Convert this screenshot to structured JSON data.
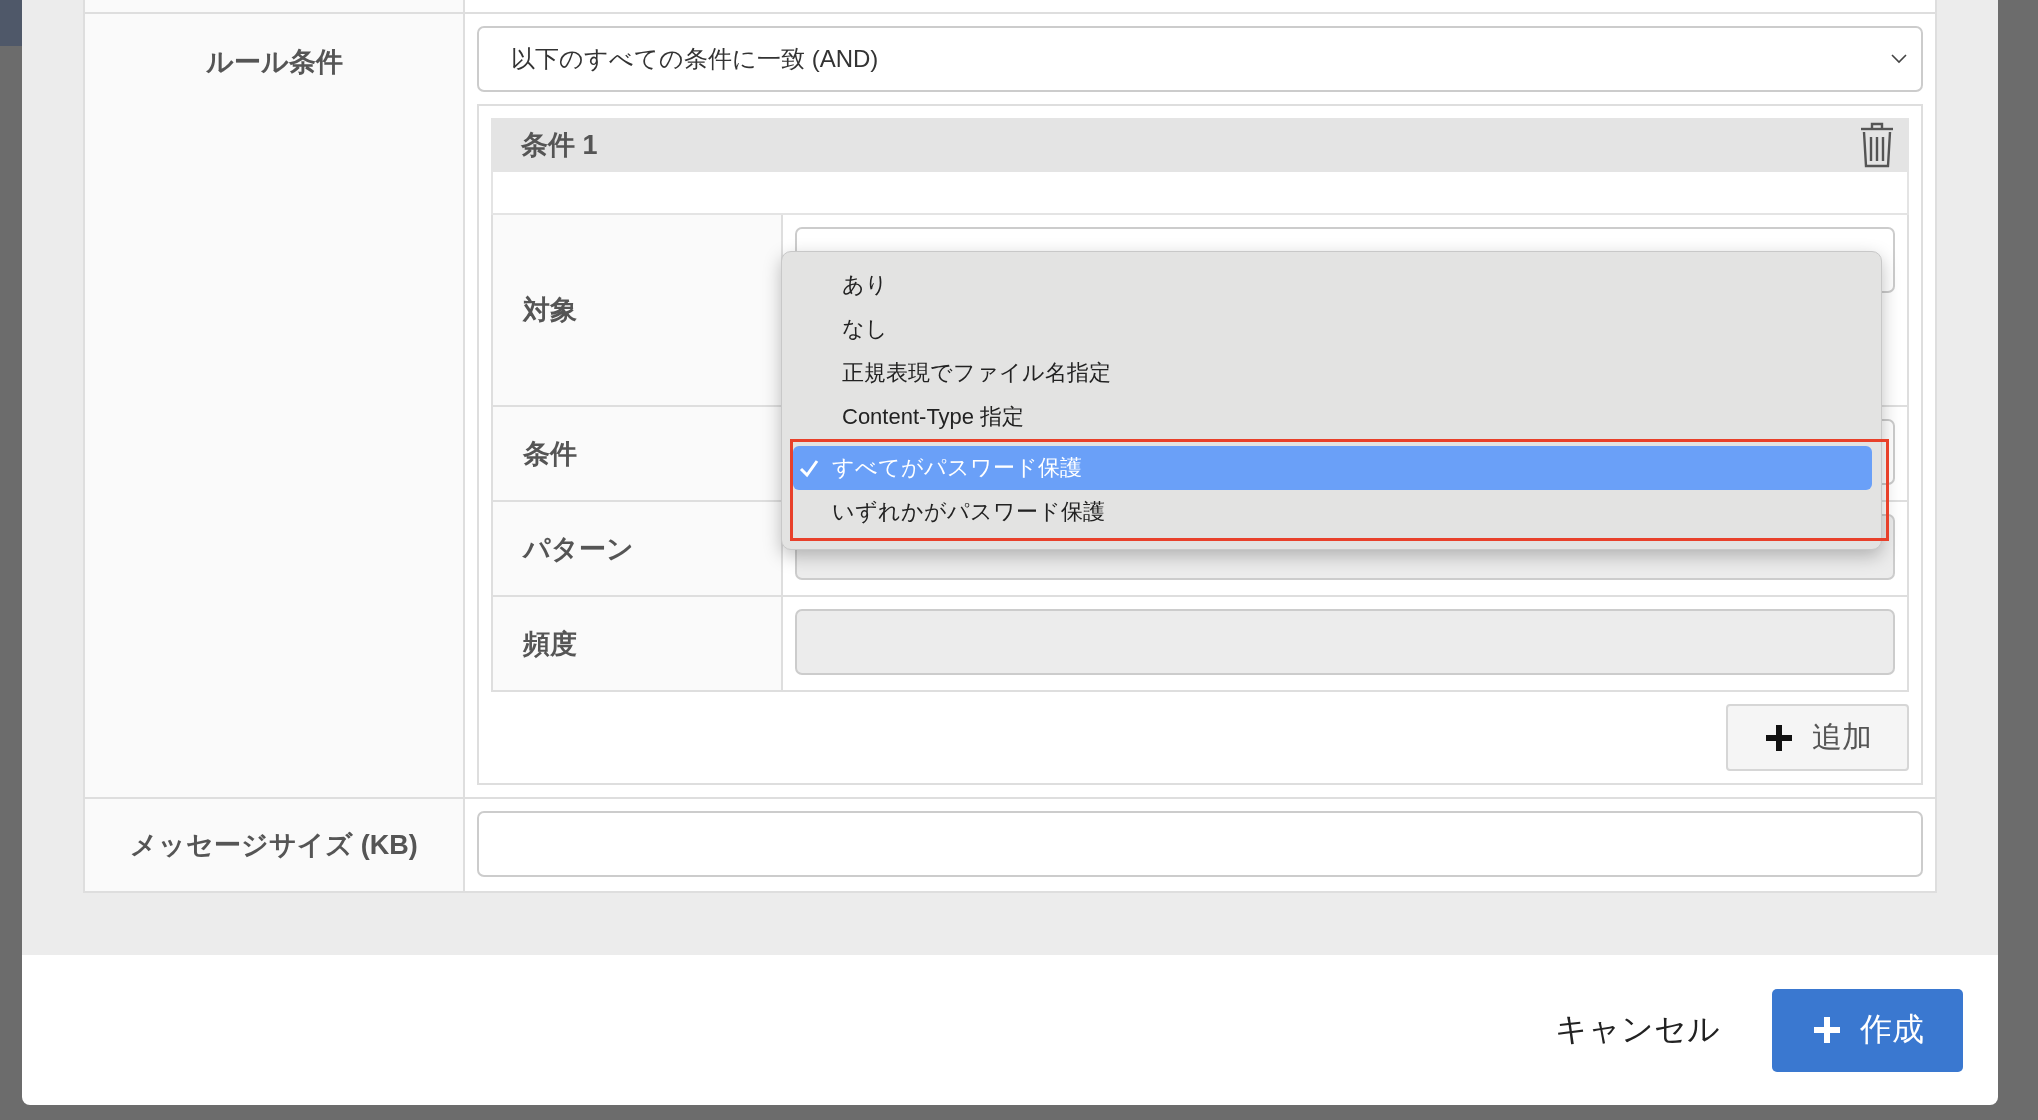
{
  "rule_condition": {
    "label": "ルール条件",
    "match_select": {
      "value": "以下のすべての条件に一致 (AND)"
    },
    "conditions": [
      {
        "title": "条件 1",
        "fields": [
          {
            "label": "対象",
            "kind": "select",
            "disabled": false
          },
          {
            "label": "条件",
            "kind": "select",
            "disabled": false
          },
          {
            "label": "パターン",
            "kind": "input",
            "disabled": true
          },
          {
            "label": "頻度",
            "kind": "input",
            "disabled": true
          }
        ]
      }
    ],
    "add_button": "追加"
  },
  "message_size": {
    "label": "メッセージサイズ (KB)"
  },
  "dropdown": {
    "options": [
      {
        "label": "あり",
        "selected": false,
        "highlighted": false
      },
      {
        "label": "なし",
        "selected": false,
        "highlighted": false
      },
      {
        "label": "正規表現でファイル名指定",
        "selected": false,
        "highlighted": false
      },
      {
        "label": "Content-Type 指定",
        "selected": false,
        "highlighted": false
      },
      {
        "label": "すべてがパスワード保護",
        "selected": true,
        "highlighted": true
      },
      {
        "label": "いずれかがパスワード保護",
        "selected": false,
        "highlighted": true
      }
    ]
  },
  "footer": {
    "cancel": "キャンセル",
    "create": "作成"
  }
}
